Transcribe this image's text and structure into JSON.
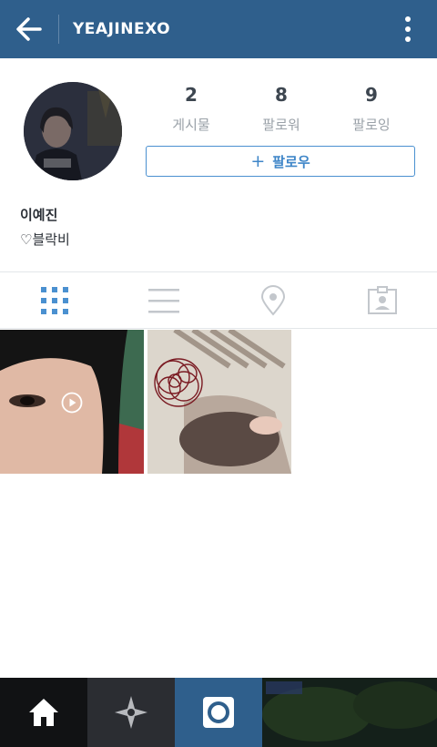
{
  "header": {
    "title": "YEAJINEXO"
  },
  "profile": {
    "stats": [
      {
        "value": "2",
        "label": "게시물"
      },
      {
        "value": "8",
        "label": "팔로워"
      },
      {
        "value": "9",
        "label": "팔로잉"
      }
    ],
    "follow_label": "팔로우",
    "name": "이예진",
    "bio": "♡블락비"
  },
  "tabs": [
    "grid-icon",
    "list-icon",
    "location-pin-icon",
    "tagged-person-icon"
  ],
  "colors": {
    "header_bg": "#2f5f8c",
    "accent": "#3f86c8",
    "active_tab": "#4a90d0",
    "inactive_tab": "#c3c7cc"
  }
}
